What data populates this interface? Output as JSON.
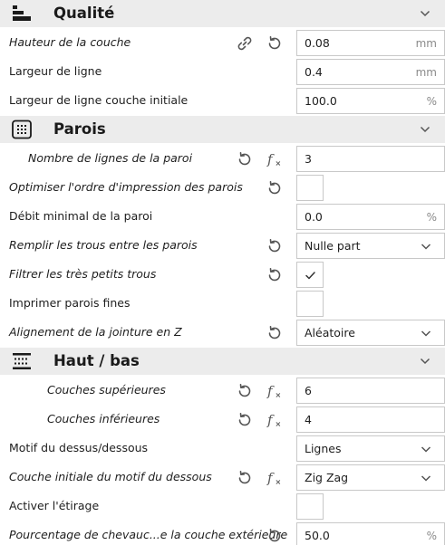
{
  "sections": {
    "quality": {
      "title": "Qualité"
    },
    "walls": {
      "title": "Parois"
    },
    "topbottom": {
      "title": "Haut / bas"
    }
  },
  "settings": {
    "layer_height": {
      "label": "Hauteur de la couche",
      "value": "0.08",
      "unit": "mm"
    },
    "line_width": {
      "label": "Largeur de ligne",
      "value": "0.4",
      "unit": "mm"
    },
    "initial_layer_line_width": {
      "label": "Largeur de ligne couche initiale",
      "value": "100.0",
      "unit": "%"
    },
    "wall_line_count": {
      "label": "Nombre de lignes de la paroi",
      "value": "3"
    },
    "optimize_wall_order": {
      "label": "Optimiser l'ordre d'impression des parois",
      "checked": false
    },
    "min_wall_flow": {
      "label": "Débit minimal de la paroi",
      "value": "0.0",
      "unit": "%"
    },
    "fill_gaps": {
      "label": "Remplir les trous entre les parois",
      "value": "Nulle part"
    },
    "filter_small_gaps": {
      "label": "Filtrer les très petits trous",
      "checked": true
    },
    "print_thin_walls": {
      "label": "Imprimer parois fines",
      "checked": false
    },
    "z_seam_alignment": {
      "label": "Alignement de la jointure en Z",
      "value": "Aléatoire"
    },
    "top_layers": {
      "label": "Couches supérieures",
      "value": "6"
    },
    "bottom_layers": {
      "label": "Couches inférieures",
      "value": "4"
    },
    "top_bottom_pattern": {
      "label": "Motif du dessus/dessous",
      "value": "Lignes"
    },
    "initial_bottom_pattern": {
      "label": "Couche initiale du motif du dessous",
      "value": "Zig Zag"
    },
    "enable_ironing": {
      "label": "Activer l'étirage",
      "checked": false
    },
    "skin_overlap": {
      "label": "Pourcentage de chevauc...e la couche extérieure",
      "value": "50.0",
      "unit": "%"
    }
  },
  "icons": {
    "link": "link-icon",
    "reset": "reset-icon",
    "function": "function-icon",
    "chevron": "chevron-down-icon",
    "check": "check-icon"
  },
  "colors": {
    "header_bg": "#ececec",
    "text": "#1e1e1e",
    "icon": "#555555",
    "border": "#c8c8c8",
    "unit": "#8a8a8a"
  }
}
